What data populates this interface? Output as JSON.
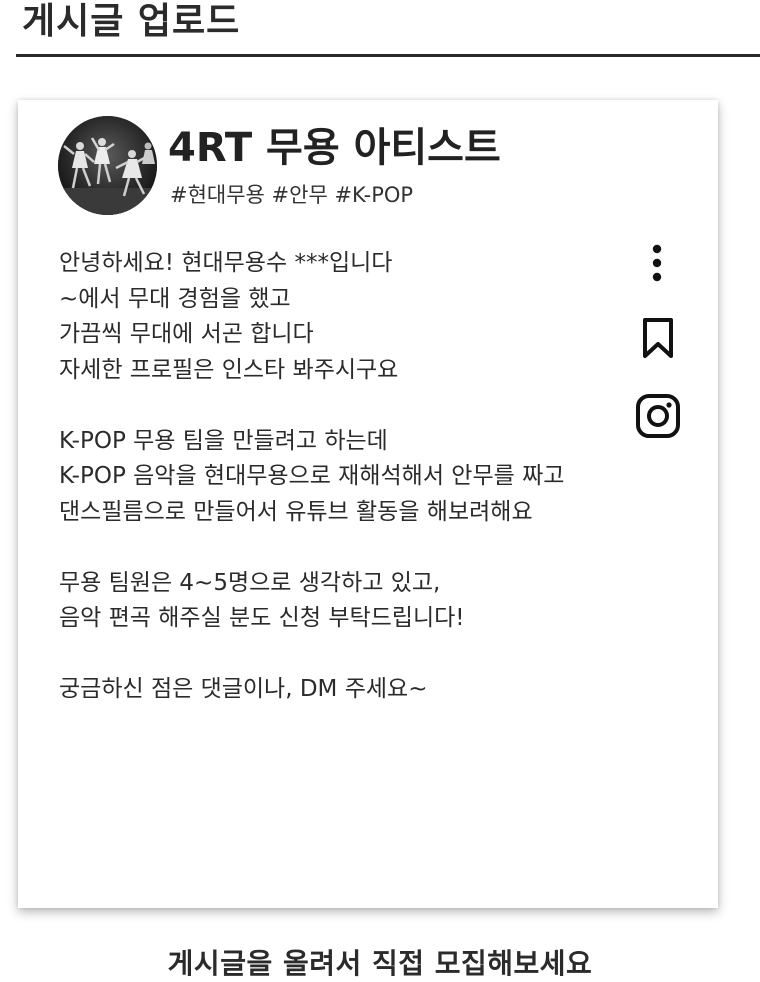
{
  "header": {
    "title": "게시글 업로드"
  },
  "post": {
    "profile": {
      "name": "4RT 무용 아티스트",
      "tags": "#현대무용 #안무 #K-POP",
      "avatar_icon": "dancers-photo"
    },
    "body_lines": [
      "안녕하세요! 현대무용수 ***입니다",
      "~에서 무대 경험을 했고",
      "가끔씩 무대에 서곤 합니다",
      "자세한 프로필은 인스타 봐주시구요",
      "",
      "K-POP 무용 팀을 만들려고 하는데",
      "K-POP 음악을 현대무용으로 재해석해서 안무를 짜고",
      "댄스필름으로 만들어서 유튜브 활동을 해보려해요",
      "",
      "무용 팀원은 4~5명으로 생각하고 있고,",
      "음악 편곡 해주실 분도 신청 부탁드립니다!",
      "",
      "궁금하신 점은 댓글이나, DM 주세요~"
    ],
    "actions": {
      "more_icon": "more-vertical-icon",
      "bookmark_icon": "bookmark-icon",
      "instagram_icon": "instagram-icon"
    }
  },
  "footer": {
    "caption": "게시글을 올려서 직접 모집해보세요"
  },
  "colors": {
    "text": "#2b2b2b",
    "rule": "#2a2a2a",
    "card_bg": "#ffffff"
  }
}
